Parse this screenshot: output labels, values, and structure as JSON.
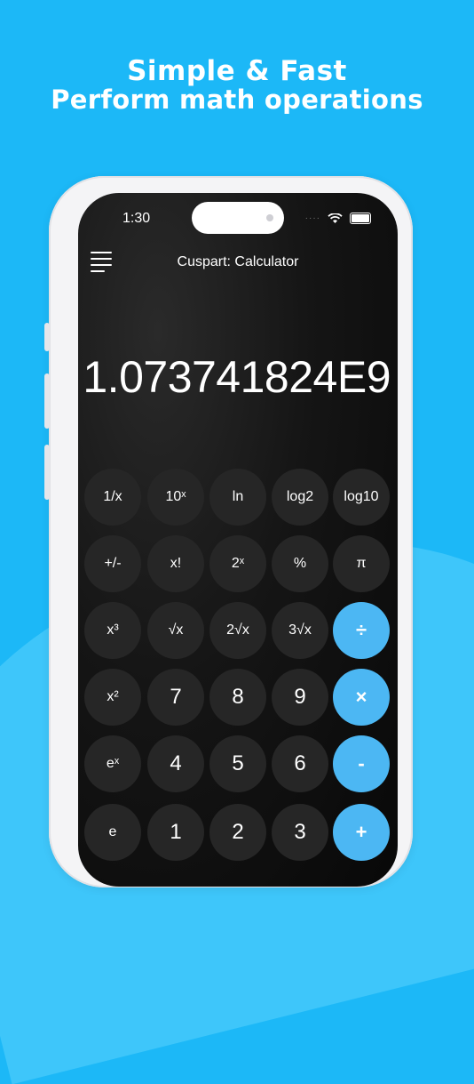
{
  "promo": {
    "headline": "Simple & Fast",
    "subheadline": "Perform math operations"
  },
  "status_bar": {
    "time": "1:30",
    "signal": "····"
  },
  "app": {
    "title": "Cuspart: Calculator",
    "display_value": "1.073741824E9"
  },
  "colors": {
    "background": "#1cb8f7",
    "operator_key": "#4cb7f3",
    "key": "#262626"
  },
  "keypad": {
    "row1": [
      "1/x",
      "10ˣ",
      "ln",
      "log2",
      "log10"
    ],
    "row2": [
      "+/-",
      "x!",
      "2ˣ",
      "%",
      "π"
    ],
    "row3": [
      "x³",
      "√x",
      "2√x",
      "3√x",
      "÷"
    ],
    "row4": [
      "x²",
      "7",
      "8",
      "9",
      "×"
    ],
    "row5": [
      "eˣ",
      "4",
      "5",
      "6",
      "-"
    ],
    "row6": [
      "e",
      "1",
      "2",
      "3",
      "+"
    ]
  }
}
